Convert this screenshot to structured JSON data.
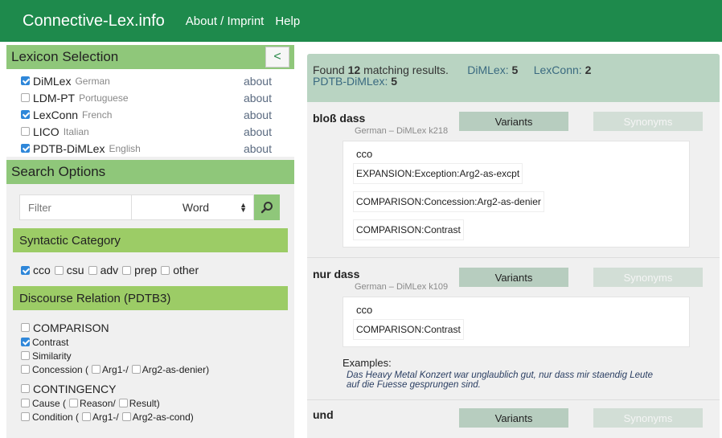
{
  "navbar": {
    "brand": "Connective-Lex.info",
    "links": [
      "About / Imprint",
      "Help"
    ]
  },
  "lexicon_selection": {
    "title": "Lexicon Selection",
    "collapse_label": "<",
    "lexicons": [
      {
        "name": "DiMLex",
        "lang": "German",
        "checked": true,
        "about": "about"
      },
      {
        "name": "LDM-PT",
        "lang": "Portuguese",
        "checked": false,
        "about": "about"
      },
      {
        "name": "LexConn",
        "lang": "French",
        "checked": true,
        "about": "about"
      },
      {
        "name": "LICO",
        "lang": "Italian",
        "checked": false,
        "about": "about"
      },
      {
        "name": "PDTB-DiMLex",
        "lang": "English",
        "checked": true,
        "about": "about"
      }
    ]
  },
  "search_options": {
    "title": "Search Options",
    "filter_placeholder": "Filter",
    "field_selected": "Word",
    "search_icon": "magnifier-icon",
    "syntactic_category": {
      "title": "Syntactic Category",
      "options": [
        {
          "label": "cco",
          "checked": true
        },
        {
          "label": "csu",
          "checked": false
        },
        {
          "label": "adv",
          "checked": false
        },
        {
          "label": "prep",
          "checked": false
        },
        {
          "label": "other",
          "checked": false
        }
      ]
    },
    "discourse_relation": {
      "title": "Discourse Relation (PDTB3)",
      "comparison": "COMPARISON",
      "contrast": "Contrast",
      "similarity": "Similarity",
      "concession": "Concession (",
      "concession_arg1": "Arg1-/",
      "concession_arg2": "Arg2-as-denier)",
      "contingency": "CONTINGENCY",
      "cause": "Cause (",
      "cause_reason": "Reason/",
      "cause_result": "Result)",
      "condition": "Condition (",
      "condition_arg1": "Arg1-/",
      "condition_arg2": "Arg2-as-cond)"
    }
  },
  "results": {
    "found_prefix": "Found",
    "count": "12",
    "found_suffix": "matching results.",
    "counts": [
      {
        "label": "DiMLex:",
        "value": "5"
      },
      {
        "label": "LexConn:",
        "value": "2"
      },
      {
        "label": "PDTB-DiMLex:",
        "value": "5"
      }
    ],
    "variants_label": "Variants",
    "synonyms_label": "Synonyms",
    "entries": [
      {
        "title": "bloß dass",
        "source": "German – DiMLex k218",
        "category": "cco",
        "senses": [
          "EXPANSION:Exception:Arg2-as-excpt",
          "COMPARISON:Concession:Arg2-as-denier",
          "COMPARISON:Contrast"
        ]
      },
      {
        "title": "nur dass",
        "source": "German – DiMLex k109",
        "category": "cco",
        "senses": [
          "COMPARISON:Contrast"
        ],
        "examples_label": "Examples:",
        "example": "Das Heavy Metal Konzert war unglaublich gut, nur dass mir staendig Leute auf die Fuesse gesprungen sind."
      },
      {
        "title": "und"
      }
    ]
  }
}
